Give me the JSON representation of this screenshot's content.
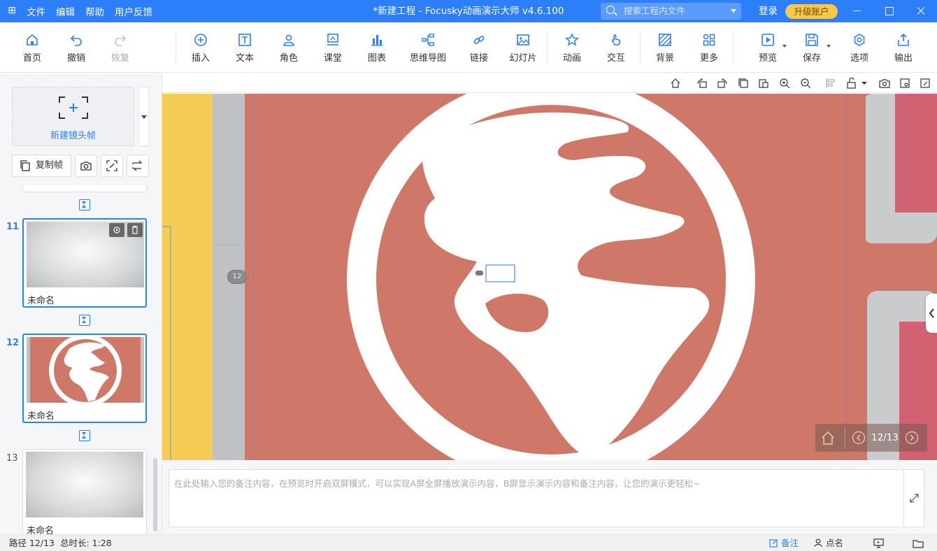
{
  "titlebar": {
    "menus": [
      "文件",
      "编辑",
      "帮助",
      "用户反馈"
    ],
    "title": "*新建工程 - Focusky动画演示大师  v4.6.100",
    "search_placeholder": "搜索工程内文件",
    "login": "登录",
    "upgrade": "升级账户"
  },
  "toolbar": {
    "home": "首页",
    "undo": "撤销",
    "redo": "恢复",
    "insert": "插入",
    "text": "文本",
    "role": "角色",
    "classroom": "课堂",
    "chart": "图表",
    "mindmap": "思维导图",
    "link": "链接",
    "slide": "幻灯片",
    "animation": "动画",
    "interaction": "交互",
    "background": "背景",
    "more": "更多",
    "preview": "预览",
    "save": "保存",
    "options": "选项",
    "export": "输出"
  },
  "left": {
    "new_frame": "新建镜头帧",
    "copy_frame": "复制帧",
    "frames": [
      {
        "number": "11",
        "name": "未命名"
      },
      {
        "number": "12",
        "name": "未命名"
      },
      {
        "number": "13",
        "name": "未命名"
      }
    ]
  },
  "canvas": {
    "frame_badge": "12",
    "page_indicator": "12/13",
    "colors": {
      "yellow": "#f5cd55",
      "earth": "#cf7867",
      "pink": "#d16271",
      "grey": "#c9cbcd"
    }
  },
  "notes": {
    "placeholder": "在此处输入您的备注内容，在预览时开启双屏模式，可以实现A屏全屏播放演示内容，B屏显示演示内容和备注内容，让您的演示更轻松~"
  },
  "statusbar": {
    "path": "路径 12/13",
    "duration": "总时长: 1:28",
    "notes": "备注",
    "rollcall": "点名"
  }
}
